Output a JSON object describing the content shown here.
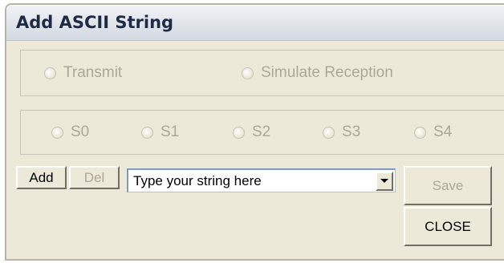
{
  "window": {
    "title": "Add ASCII String"
  },
  "mode": {
    "options": [
      "Transmit",
      "Simulate Reception"
    ]
  },
  "slots": {
    "options": [
      "S0",
      "S1",
      "S2",
      "S3",
      "S4"
    ]
  },
  "buttons": {
    "add": "Add",
    "del": "Del",
    "save": "Save",
    "close": "CLOSE"
  },
  "string_input": {
    "value": "Type your string here"
  },
  "icons": {
    "combo_arrow": "chevron-down-icon",
    "radio": "radio-button-icon"
  }
}
